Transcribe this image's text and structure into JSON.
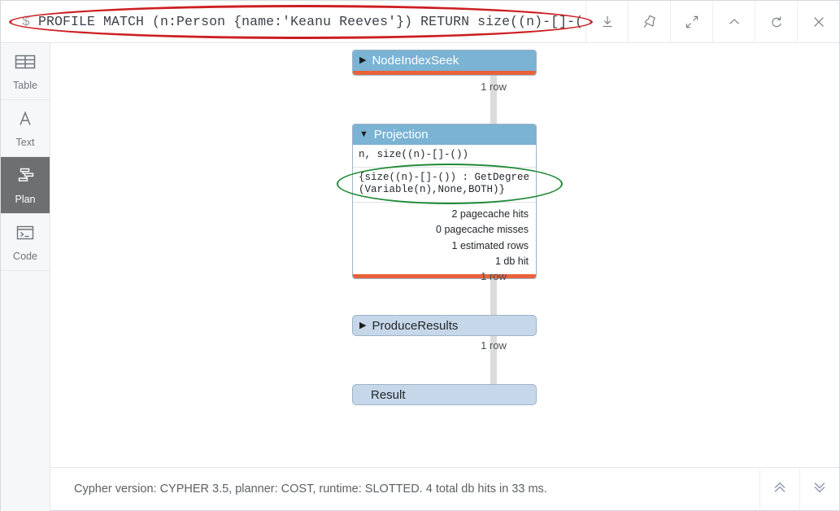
{
  "query_bar": {
    "prompt": "$",
    "query": "PROFILE MATCH (n:Person {name:'Keanu Reeves'}) RETURN size((n)-[]-())",
    "highlight_color": "#cc1f22"
  },
  "toolbar": {
    "buttons": [
      {
        "name": "download-icon",
        "label": "Download"
      },
      {
        "name": "pin-icon",
        "label": "Pin"
      },
      {
        "name": "expand-icon",
        "label": "Expand"
      },
      {
        "name": "chevron-up-icon",
        "label": "Collapse"
      },
      {
        "name": "refresh-icon",
        "label": "Rerun"
      },
      {
        "name": "close-icon",
        "label": "Close"
      }
    ]
  },
  "sidebar": {
    "items": [
      {
        "label": "Table",
        "icon": "table-icon",
        "active": false
      },
      {
        "label": "Text",
        "icon": "text-icon",
        "active": false
      },
      {
        "label": "Plan",
        "icon": "plan-icon",
        "active": true
      },
      {
        "label": "Code",
        "icon": "code-icon",
        "active": false
      }
    ]
  },
  "plan": {
    "accent_header": "#7ab3d3",
    "accent_bar": "#e8623a",
    "highlight_color": "#1f8a36",
    "operators": [
      {
        "name": "NodeIndexSeek",
        "expand_state": "collapsed",
        "triangle": "▶",
        "rows_below": "1 row"
      },
      {
        "name": "Projection",
        "expand_state": "expanded",
        "triangle": "▼",
        "identifiers": "n, size((n)-[]-())",
        "details_line1": "{size((n)-[]-()) : GetDegree",
        "details_line2": "(Variable(n),None,BOTH)}",
        "stats": [
          "2 pagecache hits",
          "0 pagecache misses",
          "1 estimated rows",
          "1 db hit"
        ],
        "rows_below": "1 row"
      },
      {
        "name": "ProduceResults",
        "expand_state": "collapsed",
        "triangle": "▶",
        "rows_below": "1 row"
      },
      {
        "name": "Result",
        "expand_state": "none",
        "triangle": ""
      }
    ]
  },
  "status": {
    "summary": "Cypher version: CYPHER 3.5, planner: COST, runtime: SLOTTED. 4 total db hits in 33 ms.",
    "buttons": [
      {
        "name": "double-chevron-up-icon",
        "label": "Scroll to top"
      },
      {
        "name": "double-chevron-down-icon",
        "label": "Scroll to bottom"
      }
    ]
  }
}
